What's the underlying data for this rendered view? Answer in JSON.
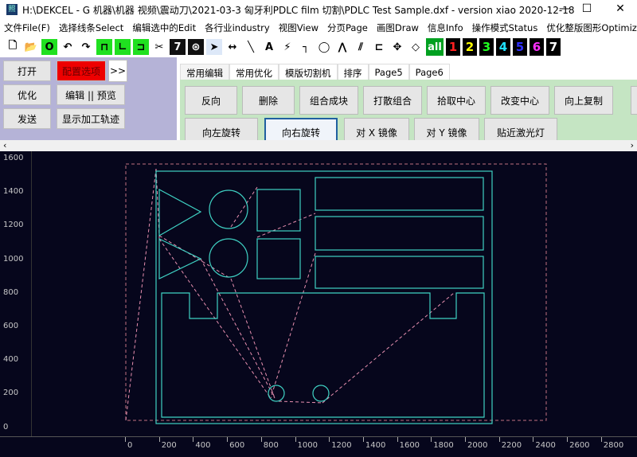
{
  "window": {
    "title": "H:\\DEKCEL - G 机器\\机器 视频\\震动刀\\2021-03-3 匈牙利PDLC film 切割\\PDLC Test Sample.dxf - version xiao 2020-12-18",
    "minimize": "—",
    "maximize": "☐",
    "close": "✕"
  },
  "menu": [
    "文件File(F)",
    "选择线条Select",
    "编辑选中的Edit",
    "各行业industry",
    "视图View",
    "分页Page",
    "画图Draw",
    "信息Info",
    "操作模式Status",
    "优化整版图形Optimize"
  ],
  "toolbar": {
    "icons": [
      "new-file",
      "open-folder",
      "circle",
      "undo",
      "redo",
      "align-top",
      "align-bottom-left",
      "rotate-90",
      "cut-scissors",
      "layer-7",
      "ring-target",
      "select-arrow",
      "measure",
      "line",
      "text",
      "path-link",
      "corner",
      "polygon",
      "angle",
      "break-line",
      "connect",
      "move",
      "node"
    ],
    "all": "all",
    "layers": [
      {
        "n": "1",
        "color": "#ff2020"
      },
      {
        "n": "2",
        "color": "#ffff00"
      },
      {
        "n": "3",
        "color": "#20ff20"
      },
      {
        "n": "4",
        "color": "#20e0ff"
      },
      {
        "n": "5",
        "color": "#3030ff"
      },
      {
        "n": "6",
        "color": "#ff30ff"
      },
      {
        "n": "7",
        "color": "#ffffff"
      }
    ]
  },
  "left_panel": {
    "open": "打开",
    "config": "配置选项",
    "more": ">>",
    "optimize": "优化",
    "edit_preview": "编辑 || 预览",
    "send": "发送",
    "show_path": "显示加工轨迹"
  },
  "tabs": [
    "常用编辑",
    "常用优化",
    "模版切割机",
    "排序",
    "Page5",
    "Page6"
  ],
  "buttons_row1": [
    "反向",
    "删除",
    "组合成块",
    "打散组合",
    "拾取中心",
    "改变中心",
    "向上复制"
  ],
  "buttons_row2": [
    "向左旋转",
    "向右旋转",
    "对 X 镜像",
    "对 Y 镜像",
    "贴近激光灯"
  ],
  "scroll": {
    "left": "‹",
    "right": "›"
  },
  "y_ticks": [
    "1600",
    "1400",
    "1200",
    "1000",
    "800",
    "600",
    "400",
    "200",
    "0"
  ],
  "x_ticks": [
    "0",
    "200",
    "400",
    "600",
    "800",
    "1000",
    "1200",
    "1400",
    "1600",
    "1800",
    "2000",
    "2200",
    "2400",
    "2600",
    "2800"
  ],
  "colors": {
    "shape": "#3fd2c4",
    "path": "#e890b0",
    "canvas": "#06061c",
    "config_bg": "#ee0000",
    "tab_area": "#c5e5c3"
  }
}
